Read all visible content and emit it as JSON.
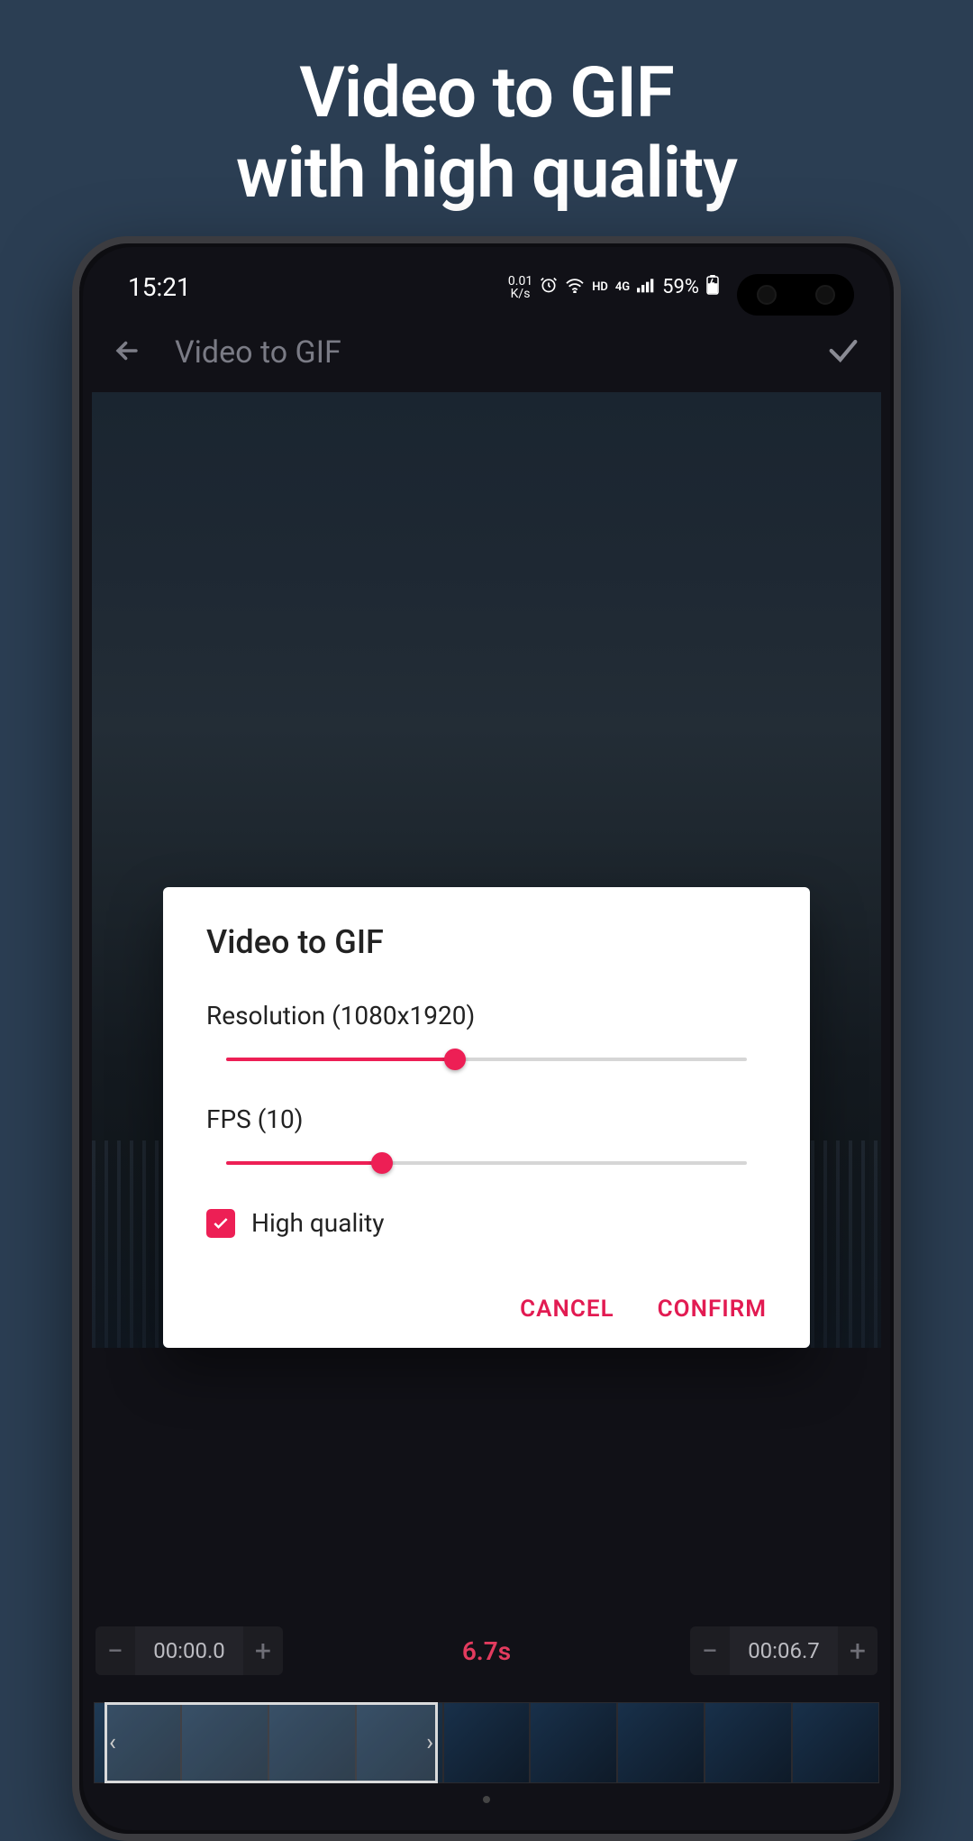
{
  "headline": {
    "line1": "Video to GIF",
    "line2": "with high quality"
  },
  "statusBar": {
    "time": "15:21",
    "netSpeed": "0.01",
    "netUnit": "K/s",
    "hd": "HD",
    "network": "4G",
    "battery": "59%"
  },
  "appBar": {
    "title": "Video to GIF"
  },
  "dialog": {
    "title": "Video to GIF",
    "resolutionLabel": "Resolution (1080x1920)",
    "resolutionPercent": 44,
    "fpsLabel": "FPS (10)",
    "fpsPercent": 30,
    "highQualityLabel": "High quality",
    "highQualityChecked": true,
    "cancelLabel": "CANCEL",
    "confirmLabel": "CONFIRM"
  },
  "timeline": {
    "startTime": "00:00.0",
    "endTime": "00:06.7",
    "duration": "6.7s"
  },
  "colors": {
    "accent": "#ed1f55",
    "bg": "#2b3e53"
  }
}
